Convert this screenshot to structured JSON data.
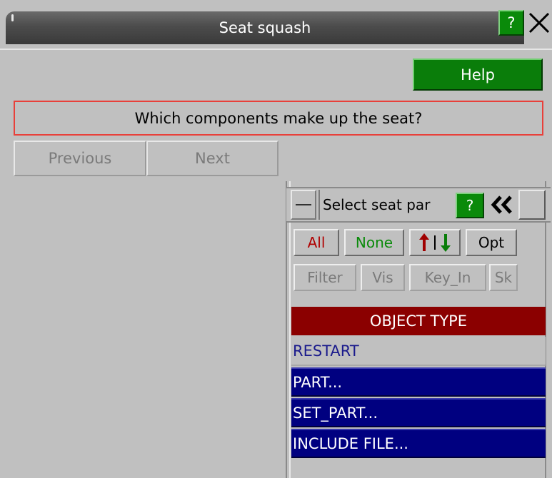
{
  "window": {
    "title": "Seat squash",
    "help_glyph": "?",
    "close_icon": "close-icon"
  },
  "help_label": "Help",
  "question": "Which components make up the seat?",
  "nav": {
    "previous": "Previous",
    "next": "Next"
  },
  "panel": {
    "title": "Select seat par",
    "help_glyph": "?",
    "buttons": {
      "all": "All",
      "none": "None",
      "opt": "Opt",
      "filter": "Filter",
      "vis": "Vis",
      "key_in": "Key_In",
      "sk": "Sk"
    },
    "object_type_header": "OBJECT TYPE",
    "rows": [
      {
        "label": "RESTART",
        "selected": false
      },
      {
        "label": "PART...",
        "selected": true
      },
      {
        "label": "SET_PART...",
        "selected": true
      },
      {
        "label": "INCLUDE FILE...",
        "selected": true
      }
    ]
  },
  "colors": {
    "background": "#c0c0c0",
    "green": "#0a7d0a",
    "dark_red": "#8b0000",
    "navy": "#000080",
    "question_border": "#e8403a"
  }
}
